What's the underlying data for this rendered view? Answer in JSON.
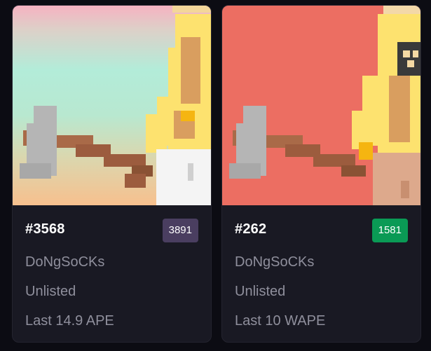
{
  "cards": [
    {
      "title": "#3568",
      "rank": "3891",
      "rank_color": "#4a3e60",
      "collection": "DoNgSoCKs",
      "status": "Unlisted",
      "last_sale": "Last 14.9 APE",
      "bg_gradient": [
        "#f6b3c0",
        "#b0eddb",
        "#f6c38d"
      ]
    },
    {
      "title": "#262",
      "rank": "1581",
      "rank_color": "#0a9a55",
      "collection": "DoNgSoCKs",
      "status": "Unlisted",
      "last_sale": "Last 10 WAPE",
      "bg_color": "#ec6e62"
    }
  ]
}
